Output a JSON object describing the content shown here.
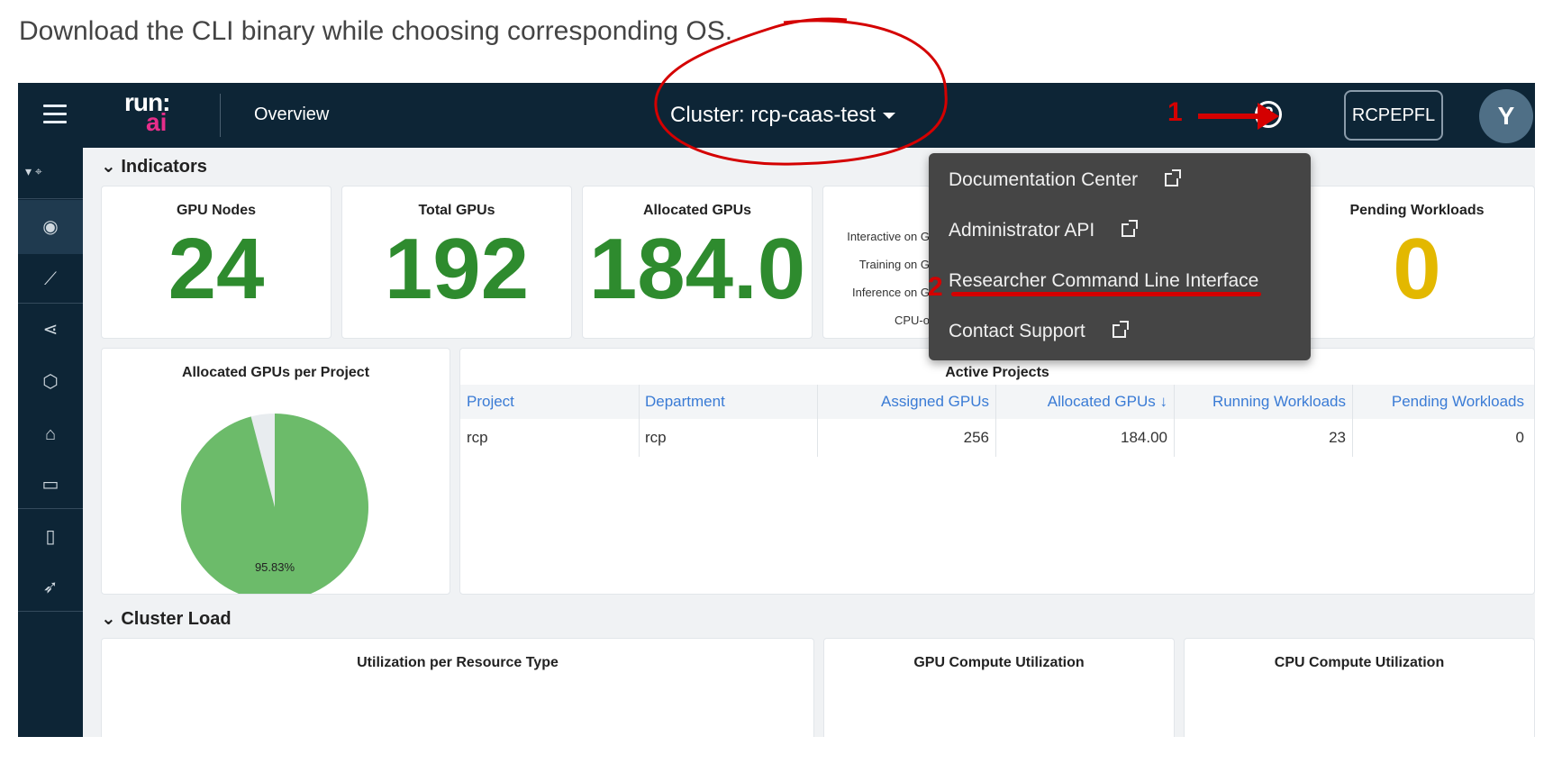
{
  "caption": "Download the CLI binary while choosing corresponding OS.",
  "topbar": {
    "logo_top": "run:",
    "logo_bottom": "ai",
    "page": "Overview",
    "cluster_label": "Cluster: rcp-caas-test",
    "tenant": "RCPEPFL",
    "avatar_letter": "Y"
  },
  "sections": {
    "indicators": "Indicators",
    "cluster_load": "Cluster Load"
  },
  "indicators": {
    "gpu_nodes": {
      "title": "GPU Nodes",
      "value": "24"
    },
    "total_gpus": {
      "title": "Total GPUs",
      "value": "192"
    },
    "allocated_gpus": {
      "title": "Allocated GPUs",
      "value": "184.0"
    },
    "workload_types": [
      "Interactive on G",
      "Training on G",
      "Inference on G",
      "CPU-o"
    ],
    "pending_workloads": {
      "title": "Pending Workloads",
      "value": "0"
    }
  },
  "pie": {
    "title": "Allocated GPUs per Project",
    "label": "95.83%"
  },
  "active_projects": {
    "title": "Active Projects",
    "headers": [
      "Project",
      "Department",
      "Assigned GPUs",
      "Allocated GPUs ↓",
      "Running Workloads",
      "Pending Workloads"
    ],
    "rows": [
      [
        "rcp",
        "rcp",
        "256",
        "184.00",
        "23",
        "0"
      ]
    ]
  },
  "cluster_load_cards": [
    "Utilization per Resource Type",
    "GPU Compute Utilization",
    "CPU Compute Utilization"
  ],
  "help_menu": [
    "Documentation Center",
    "Administrator API",
    "Researcher Command Line Interface",
    "Contact Support"
  ],
  "annotations": {
    "step1": "1",
    "step2": "2"
  },
  "colors": {
    "topbar": "#0d2536",
    "accent_green": "#2e8b2e",
    "pending_yellow": "#e3b800",
    "annotation_red": "#d40000",
    "pie_green": "#6cbb6a"
  }
}
